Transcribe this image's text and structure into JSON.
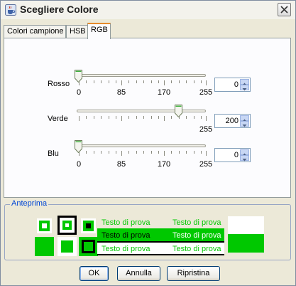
{
  "window": {
    "title": "Scegliere Colore",
    "icon": "java-cup-icon"
  },
  "tabs": [
    {
      "label": "Colori campione",
      "active": false
    },
    {
      "label": "HSB",
      "active": false
    },
    {
      "label": "RGB",
      "active": true
    }
  ],
  "sliders": {
    "red": {
      "label": "Rosso",
      "value": "0"
    },
    "green": {
      "label": "Verde",
      "value": "200"
    },
    "blue": {
      "label": "Blu",
      "value": "0"
    },
    "min": 0,
    "max": 255,
    "tick_labels": [
      "0",
      "85",
      "170",
      "255"
    ]
  },
  "preview": {
    "label": "Anteprima",
    "sample_text": "Testo di prova",
    "color": "#00c800"
  },
  "buttons": {
    "ok": "OK",
    "cancel": "Annulla",
    "reset": "Ripristina"
  }
}
